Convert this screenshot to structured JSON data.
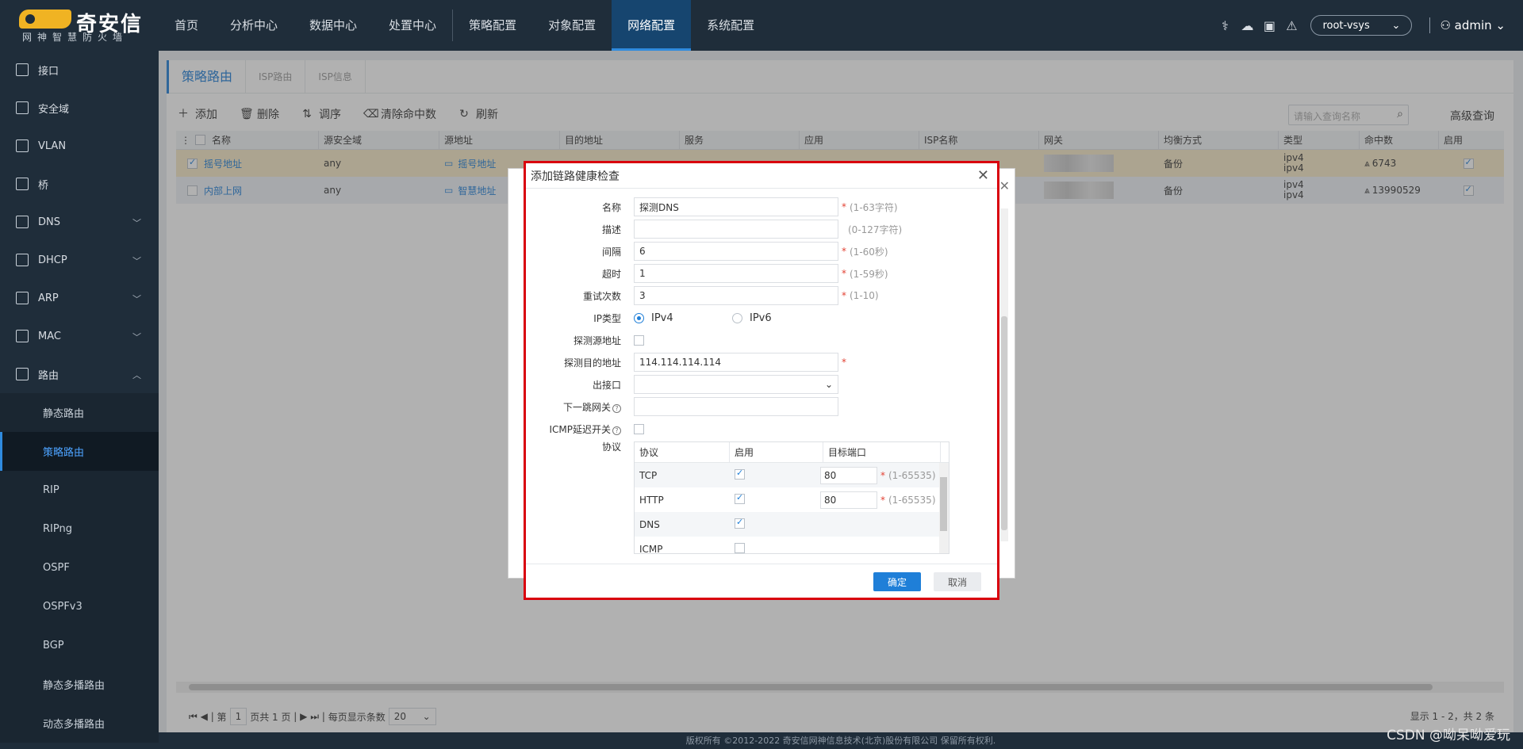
{
  "brand": {
    "name": "奇安信",
    "mark": "奇安",
    "slogan": "网神智慧防火墙"
  },
  "nav": [
    "首页",
    "分析中心",
    "数据中心",
    "处置中心",
    "策略配置",
    "对象配置",
    "网络配置",
    "系统配置"
  ],
  "nav_active_index": 6,
  "vsys": "root-vsys",
  "user": "admin",
  "sidebar": {
    "items": [
      "接口",
      "安全域",
      "VLAN",
      "桥",
      "DNS",
      "DHCP",
      "ARP",
      "MAC",
      "路由"
    ],
    "sub": [
      "静态路由",
      "策略路由",
      "RIP",
      "RIPng",
      "OSPF",
      "OSPFv3",
      "BGP",
      "静态多播路由",
      "动态多播路由"
    ],
    "sub_active_index": 1
  },
  "subtabs": [
    "策略路由",
    "ISP路由",
    "ISP信息"
  ],
  "toolbar": {
    "add": "添加",
    "delete": "删除",
    "order": "调序",
    "clear": "清除命中数",
    "refresh": "刷新",
    "search_placeholder": "请输入查询名称",
    "advanced": "高级查询"
  },
  "table": {
    "columns": [
      "名称",
      "源安全域",
      "源地址",
      "目的地址",
      "服务",
      "应用",
      "ISP名称",
      "网关",
      "均衡方式",
      "类型",
      "命中数",
      "启用"
    ],
    "rows": [
      {
        "name": "摇号地址",
        "zone": "any",
        "src": "摇号地址",
        "balance": "备份",
        "type1": "ipv4",
        "type2": "ipv4",
        "hits": "6743"
      },
      {
        "name": "内部上网",
        "zone": "any",
        "src": "智慧地址",
        "balance": "备份",
        "type1": "ipv4",
        "type2": "ipv4",
        "hits": "13990529"
      }
    ]
  },
  "pager": {
    "page_label": "第",
    "page": "1",
    "total": "页共 1 页",
    "per_page_label": "每页显示条数",
    "per_page": "20",
    "info": "显示 1 - 2，共 2 条"
  },
  "footer": "版权所有 ©2012-2022 奇安信网神信息技术(北京)股份有限公司 保留所有权利.",
  "watermark": "CSDN @呦呆呦爱玩",
  "dialog": {
    "title": "添加链路健康检查",
    "fields": {
      "name": {
        "label": "名称",
        "value": "探测DNS",
        "hint": "(1-63字符)"
      },
      "desc": {
        "label": "描述",
        "value": "",
        "hint": "(0-127字符)"
      },
      "interval": {
        "label": "间隔",
        "value": "6",
        "hint": "(1-60秒)"
      },
      "timeout": {
        "label": "超时",
        "value": "1",
        "hint": "(1-59秒)"
      },
      "retry": {
        "label": "重试次数",
        "value": "3",
        "hint": "(1-10)"
      },
      "iptype": {
        "label": "IP类型",
        "opt1": "IPv4",
        "opt2": "IPv6"
      },
      "srcaddr": {
        "label": "探测源地址"
      },
      "dstaddr": {
        "label": "探测目的地址",
        "value": "114.114.114.114"
      },
      "outif": {
        "label": "出接口"
      },
      "nexthop": {
        "label": "下一跳网关"
      },
      "icmp": {
        "label": "ICMP延迟开关"
      },
      "proto": {
        "label": "协议"
      }
    },
    "proto_table": {
      "columns": [
        "协议",
        "启用",
        "目标端口"
      ],
      "rows": [
        {
          "name": "TCP",
          "port": "80",
          "hint": "(1-65535)"
        },
        {
          "name": "HTTP",
          "port": "80",
          "hint": "(1-65535)"
        },
        {
          "name": "DNS",
          "port": "",
          "hint": ""
        },
        {
          "name": "ICMP",
          "port": "",
          "hint": ""
        }
      ]
    },
    "ok": "确定",
    "cancel": "取消"
  },
  "colors": {
    "nav_bg": "#1f2d3a",
    "accent": "#1f7fd8",
    "highlight_row": "#f6e8c6",
    "dialog_border": "#d9000d"
  }
}
